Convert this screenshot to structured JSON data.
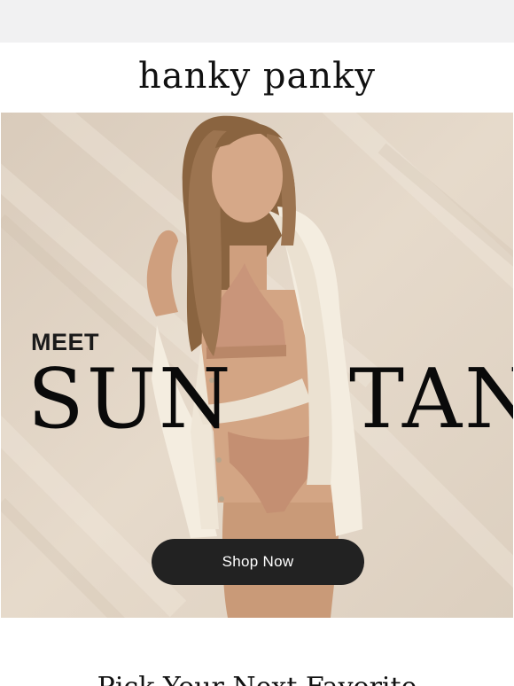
{
  "brand": {
    "logo_text": "hanky panky"
  },
  "hero": {
    "eyebrow": "MEET",
    "word_left": "SUN",
    "word_right": "TAN",
    "cta_label": "Shop Now"
  },
  "next_section": {
    "heading": "Pick Your Next Favorite"
  },
  "colors": {
    "page_bg": "#f1f1f2",
    "hero_bg": "#e0d3c4",
    "button_bg": "#222222",
    "button_text": "#ffffff"
  }
}
